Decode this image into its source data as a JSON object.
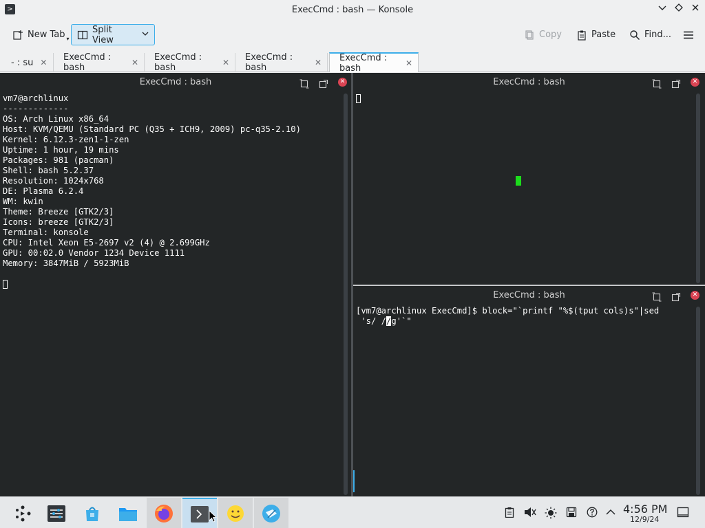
{
  "window": {
    "title": "ExecCmd : bash — Konsole",
    "app_icon": "terminal-icon",
    "controls": [
      "minimize",
      "keep-above",
      "close"
    ]
  },
  "toolbar": {
    "new_tab": "New Tab",
    "split_view": "Split View",
    "copy": "Copy",
    "paste": "Paste",
    "find": "Find..."
  },
  "tabs": [
    {
      "label": "- : su"
    },
    {
      "label": "ExecCmd : bash"
    },
    {
      "label": "ExecCmd : bash"
    },
    {
      "label": "ExecCmd : bash"
    },
    {
      "label": "ExecCmd : bash",
      "active": true
    }
  ],
  "panes": {
    "left": {
      "title": "ExecCmd : bash",
      "lines": [
        "vm7@archlinux",
        "-------------",
        "OS: Arch Linux x86_64",
        "Host: KVM/QEMU (Standard PC (Q35 + ICH9, 2009) pc-q35-2.10)",
        "Kernel: 6.12.3-zen1-1-zen",
        "Uptime: 1 hour, 19 mins",
        "Packages: 981 (pacman)",
        "Shell: bash 5.2.37",
        "Resolution: 1024x768",
        "DE: Plasma 6.2.4",
        "WM: kwin",
        "Theme: Breeze [GTK2/3]",
        "Icons: breeze [GTK2/3]",
        "Terminal: konsole",
        "CPU: Intel Xeon E5-2697 v2 (4) @ 2.699GHz",
        "GPU: 00:02.0 Vendor 1234 Device 1111",
        "Memory: 3847MiB / 5923MiB"
      ]
    },
    "top_right": {
      "title": "ExecCmd : bash"
    },
    "bottom_right": {
      "title": "ExecCmd : bash",
      "line1": "[vm7@archlinux ExecCmd]$ block=\"`printf \"%$(tput cols)s\"|sed",
      "line2_pre": " 's/ /",
      "line2_cursor": "/",
      "line2_post": "g'`\""
    }
  },
  "taskbar": {
    "items": [
      "app-launcher-icon",
      "system-settings-icon",
      "discover-icon",
      "file-manager-icon",
      "firefox-icon",
      "konsole-icon",
      "smiley-app-icon",
      "krfb-icon"
    ],
    "tray": [
      "clipboard-icon",
      "volume-muted-icon",
      "brightness-icon",
      "storage-icon",
      "help-icon",
      "chevron-up-icon"
    ],
    "time": "4:56 PM",
    "date": "12/9/24"
  },
  "colors": {
    "accent": "#3daee9",
    "terminal_bg": "#232627",
    "close_red": "#da4453",
    "green_block": "#1cdc1c"
  }
}
